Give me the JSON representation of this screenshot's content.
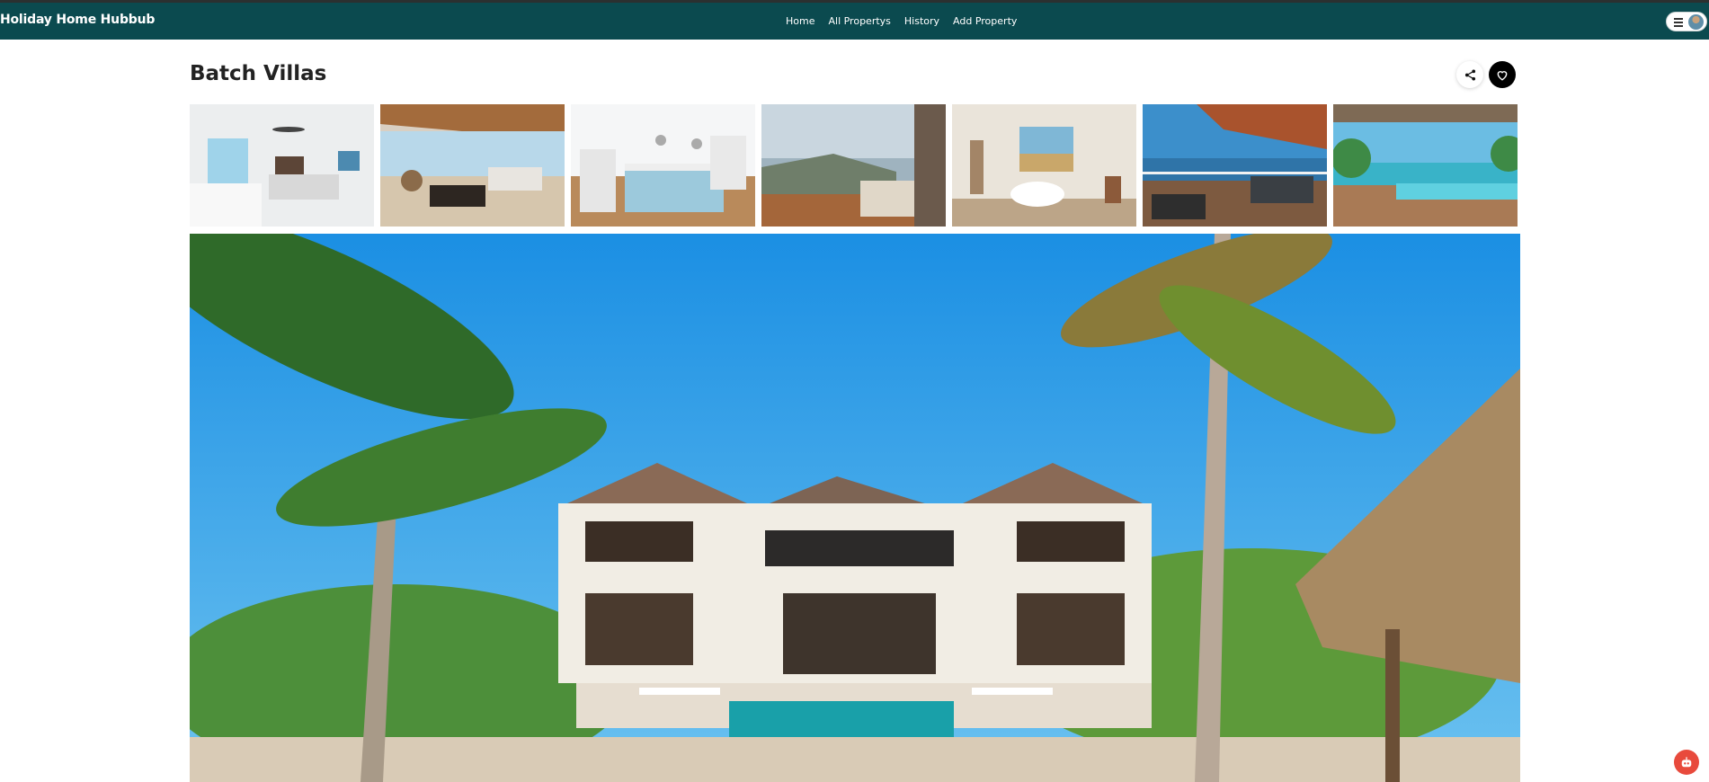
{
  "navbar": {
    "brand": "Holiday Home Hubbub",
    "links": [
      "Home",
      "All Propertys",
      "History",
      "Add Property"
    ]
  },
  "property": {
    "title": "Batch Villas"
  },
  "colors": {
    "nav_bg": "#0b4a4f",
    "accent_red": "#e84a3c"
  },
  "icons": [
    "menu-icon",
    "share-icon",
    "heart-icon",
    "robot-icon"
  ],
  "gallery": {
    "thumbnails": [
      "bedroom-ocean-view",
      "living-room-wood-ceiling",
      "white-kitchen-island",
      "cliff-view-bedroom",
      "bathroom-tub-window",
      "balcony-ocean-view",
      "pool-deck-pergola"
    ],
    "main_image": "beachfront-villa-palm-trees"
  }
}
